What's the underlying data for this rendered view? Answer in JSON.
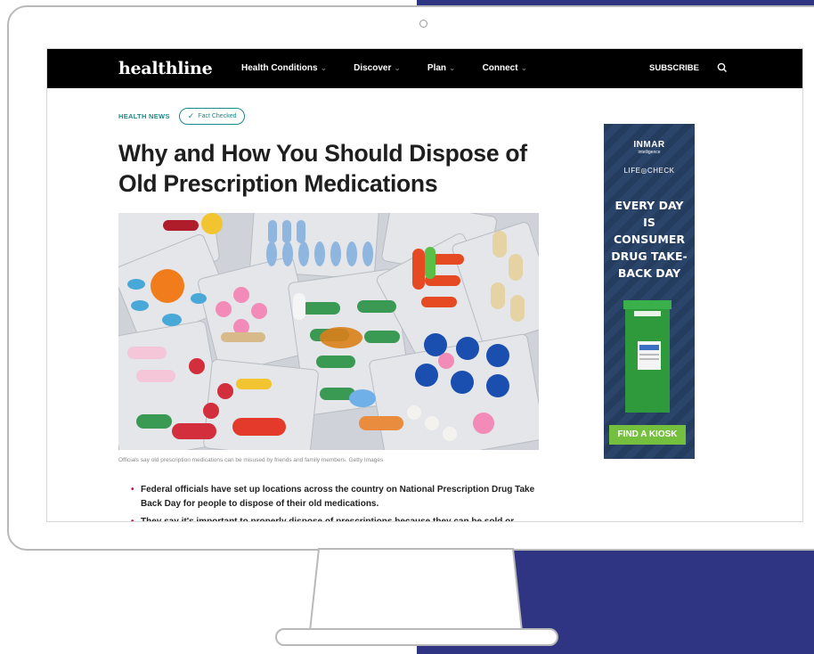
{
  "navbar": {
    "logo": "healthline",
    "items": [
      {
        "label": "Health Conditions"
      },
      {
        "label": "Discover"
      },
      {
        "label": "Plan"
      },
      {
        "label": "Connect"
      }
    ],
    "subscribe": "SUBSCRIBE",
    "search_icon": "search-icon"
  },
  "article": {
    "kicker": "HEALTH NEWS",
    "fact_checked": "Fact Checked",
    "title": "Why and How You Should Dispose of Old Prescription Medications",
    "caption": "Officials say old prescription medications can be misused by friends and family members. Getty Images",
    "bullets": [
      "Federal officials have set up locations across the country on National Prescription Drug Take Back Day for people to dispose of their old medications.",
      "They say it's important to properly dispose of prescriptions because they can be sold or"
    ]
  },
  "ad": {
    "brand1": "INMAR",
    "brand1_sub": "intelligence",
    "brand2": "LIFE◎CHECK",
    "headline": "EVERY DAY IS CONSUMER DRUG TAKE-BACK DAY",
    "button": "FIND A KIOSK"
  },
  "colors": {
    "accent_teal": "#1a8a89",
    "navy_background": "#2f3582",
    "ad_green": "#75bf3f",
    "bullet": "#d0104c"
  }
}
